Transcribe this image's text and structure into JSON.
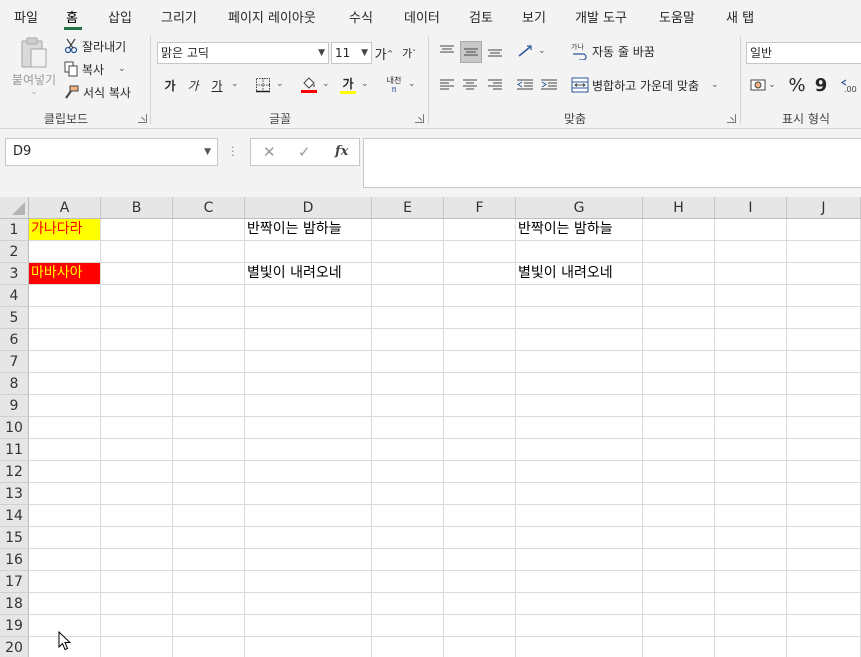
{
  "menu": {
    "tabs": [
      "파일",
      "홈",
      "삽입",
      "그리기",
      "페이지 레이아웃",
      "수식",
      "데이터",
      "검토",
      "보기",
      "개발 도구",
      "도움말",
      "새 탭"
    ],
    "active": "홈"
  },
  "ribbon": {
    "clipboard": {
      "paste_label": "붙여넣기",
      "cut_label": "잘라내기",
      "copy_label": "복사",
      "format_painter_label": "서식 복사",
      "group_label": "클립보드"
    },
    "font": {
      "font_name": "맑은 고딕",
      "font_size": "11",
      "grow_label": "가",
      "shrink_label": "가",
      "bold_label": "가",
      "italic_label": "가",
      "underline_label": "가",
      "font_color_label": "가",
      "phonetic_label": "내천",
      "group_label": "글꼴",
      "fill_color": "#ff0000",
      "font_color": "#ffff00"
    },
    "alignment": {
      "wrap_label": "자동 줄 바꿈",
      "merge_label": "병합하고 가운데 맞춤",
      "group_label": "맞춤"
    },
    "number": {
      "format": "일반",
      "percent": "%",
      "comma": "9",
      "group_label": "표시 형식"
    }
  },
  "formula_bar": {
    "name_box": "D9",
    "cancel": "✕",
    "enter": "✓",
    "fx": "fx",
    "content": ""
  },
  "sheet": {
    "columns": [
      "A",
      "B",
      "C",
      "D",
      "E",
      "F",
      "G",
      "H",
      "I",
      "J"
    ],
    "rows": [
      "1",
      "2",
      "3",
      "4",
      "5",
      "6",
      "7",
      "8",
      "9",
      "10",
      "11",
      "12",
      "13",
      "14",
      "15",
      "16",
      "17",
      "18",
      "19",
      "20"
    ],
    "cells": {
      "A1": {
        "text": "가나다라",
        "bg": "#ffff00",
        "color": "#ff0000"
      },
      "A3": {
        "text": "마바사아",
        "bg": "#ff0000",
        "color": "#ffff00"
      },
      "D1": {
        "text": "반짝이는 밤하늘"
      },
      "D3": {
        "text": "별빛이 내려오네"
      },
      "G1": {
        "text": "반짝이는 밤하늘"
      },
      "G3": {
        "text": "별빛이 내려오네"
      }
    }
  }
}
